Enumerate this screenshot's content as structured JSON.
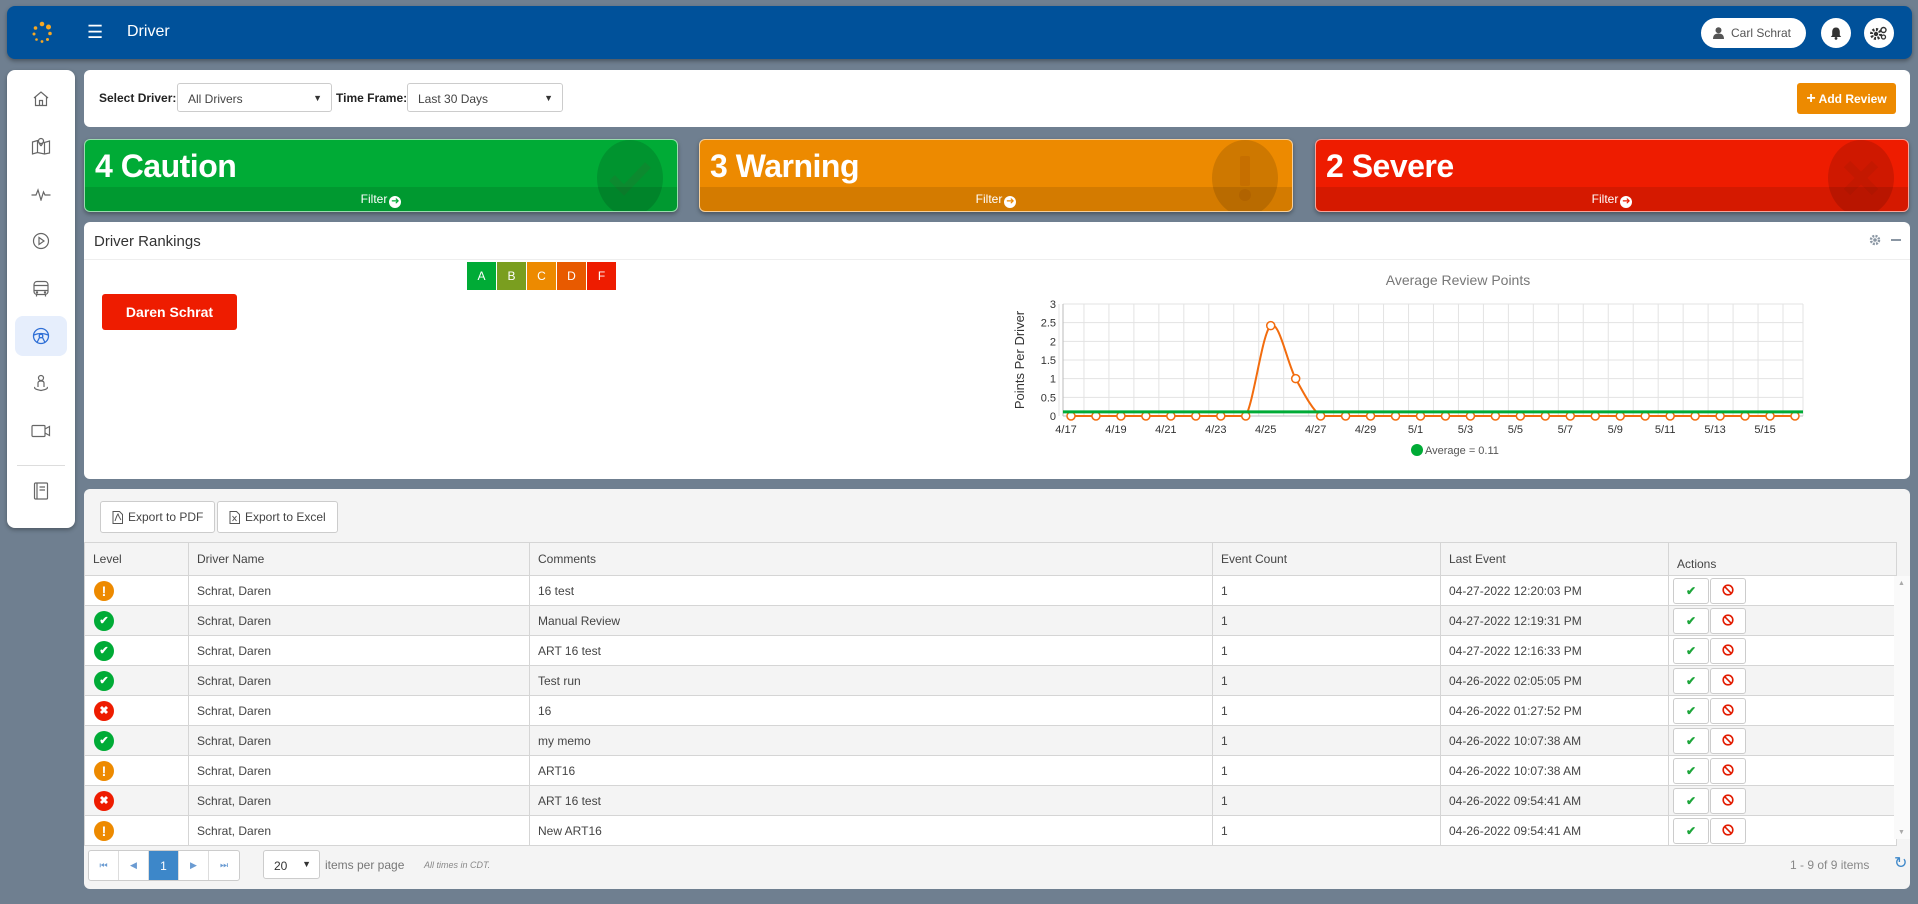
{
  "header": {
    "title": "Driver",
    "user_name": "Carl Schrat",
    "icons": {
      "logo": "dots-ring-logo",
      "menu": "hamburger-icon",
      "user": "user-icon",
      "bell": "bell-icon",
      "settings": "gears-icon"
    }
  },
  "sidebar": {
    "items": [
      {
        "name": "home",
        "icon": "home-icon",
        "active": false
      },
      {
        "name": "map",
        "icon": "map-pin-icon",
        "active": false
      },
      {
        "name": "activity",
        "icon": "pulse-icon",
        "active": false
      },
      {
        "name": "playback",
        "icon": "play-circle-icon",
        "active": false
      },
      {
        "name": "vehicles",
        "icon": "bus-icon",
        "active": false
      },
      {
        "name": "driver",
        "icon": "steering-wheel-icon",
        "active": true
      },
      {
        "name": "location",
        "icon": "person-pin-icon",
        "active": false
      },
      {
        "name": "video",
        "icon": "video-camera-icon",
        "active": false
      },
      {
        "name": "reports",
        "icon": "book-icon",
        "active": false
      }
    ]
  },
  "filters": {
    "driver_label": "Select Driver:",
    "driver_value": "All Drivers",
    "timeframe_label": "Time Frame:",
    "timeframe_value": "Last 30 Days",
    "add_review_label": "Add Review"
  },
  "summary_cards": [
    {
      "label": "4 Caution",
      "count": 4,
      "level": "Caution",
      "filter": "Filter",
      "color": "#00ab36",
      "icon": "check-icon"
    },
    {
      "label": "3 Warning",
      "count": 3,
      "level": "Warning",
      "filter": "Filter",
      "color": "#ed8a00",
      "icon": "exclamation-icon"
    },
    {
      "label": "2 Severe",
      "count": 2,
      "level": "Severe",
      "filter": "Filter",
      "color": "#ee1c00",
      "icon": "x-icon"
    }
  ],
  "rankings": {
    "title": "Driver Rankings",
    "grades": [
      {
        "label": "A",
        "color": "#00ab36"
      },
      {
        "label": "B",
        "color": "#7a9e1f"
      },
      {
        "label": "C",
        "color": "#ed8a00"
      },
      {
        "label": "D",
        "color": "#e85a00"
      },
      {
        "label": "F",
        "color": "#ee1c00"
      }
    ],
    "drivers": [
      {
        "name": "Daren Schrat",
        "color": "#ee1c00"
      }
    ]
  },
  "chart_data": {
    "type": "line",
    "title": "Average Review Points",
    "xlabel": "",
    "ylabel": "Points Per Driver",
    "ylim": [
      0,
      3
    ],
    "yticks": [
      "0",
      "0.5",
      "1",
      "1.5",
      "2",
      "2.5",
      "3"
    ],
    "x": [
      "4/17",
      "4/18",
      "4/19",
      "4/20",
      "4/21",
      "4/22",
      "4/23",
      "4/24",
      "4/25",
      "4/26",
      "4/27",
      "4/28",
      "4/29",
      "4/30",
      "5/1",
      "5/2",
      "5/3",
      "5/4",
      "5/5",
      "5/6",
      "5/7",
      "5/8",
      "5/9",
      "5/10",
      "5/11",
      "5/12",
      "5/13",
      "5/14",
      "5/15",
      "5/16"
    ],
    "xtick_labels": [
      "4/17",
      "4/19",
      "4/21",
      "4/23",
      "4/25",
      "4/27",
      "4/29",
      "5/1",
      "5/3",
      "5/5",
      "5/7",
      "5/9",
      "5/11",
      "5/13",
      "5/15"
    ],
    "series": [
      {
        "name": "Points",
        "color": "#f26c0e",
        "values": [
          0,
          0,
          0,
          0,
          0,
          0,
          0,
          0,
          2.42,
          1.0,
          0,
          0,
          0,
          0,
          0,
          0,
          0,
          0,
          0,
          0,
          0,
          0,
          0,
          0,
          0,
          0,
          0,
          0,
          0,
          0
        ]
      },
      {
        "name": "Average = 0.11",
        "color": "#00ab36",
        "values": [
          0.11
        ]
      }
    ],
    "legend": "bottom",
    "legend_label": "Average = 0.11",
    "grid": true
  },
  "table": {
    "export_pdf": "Export to PDF",
    "export_excel": "Export to Excel",
    "columns": [
      "Level",
      "Driver Name",
      "Comments",
      "Event Count",
      "Last Event",
      "Actions"
    ],
    "rows": [
      {
        "level": "warning",
        "driver": "Schrat, Daren",
        "comment": "16 test",
        "count": "1",
        "last_event": "04-27-2022 12:20:03 PM"
      },
      {
        "level": "caution",
        "driver": "Schrat, Daren",
        "comment": "Manual Review",
        "count": "1",
        "last_event": "04-27-2022 12:19:31 PM"
      },
      {
        "level": "caution",
        "driver": "Schrat, Daren",
        "comment": "ART 16 test",
        "count": "1",
        "last_event": "04-27-2022 12:16:33 PM"
      },
      {
        "level": "caution",
        "driver": "Schrat, Daren",
        "comment": "Test run",
        "count": "1",
        "last_event": "04-26-2022 02:05:05 PM"
      },
      {
        "level": "severe",
        "driver": "Schrat, Daren",
        "comment": "16",
        "count": "1",
        "last_event": "04-26-2022 01:27:52 PM"
      },
      {
        "level": "caution",
        "driver": "Schrat, Daren",
        "comment": "my memo",
        "count": "1",
        "last_event": "04-26-2022 10:07:38 AM"
      },
      {
        "level": "warning",
        "driver": "Schrat, Daren",
        "comment": "ART16",
        "count": "1",
        "last_event": "04-26-2022 10:07:38 AM"
      },
      {
        "level": "severe",
        "driver": "Schrat, Daren",
        "comment": "ART 16 test",
        "count": "1",
        "last_event": "04-26-2022 09:54:41 AM"
      },
      {
        "level": "warning",
        "driver": "Schrat, Daren",
        "comment": "New ART16",
        "count": "1",
        "last_event": "04-26-2022 09:54:41 AM"
      }
    ],
    "level_colors": {
      "caution": "#00ab36",
      "warning": "#ed8a00",
      "severe": "#ee1c00"
    },
    "pager": {
      "current_page": "1",
      "page_size": "20",
      "items_per_page_label": "items per page",
      "tz_note": "All times in CDT.",
      "count_text": "1 - 9 of 9 items"
    }
  }
}
